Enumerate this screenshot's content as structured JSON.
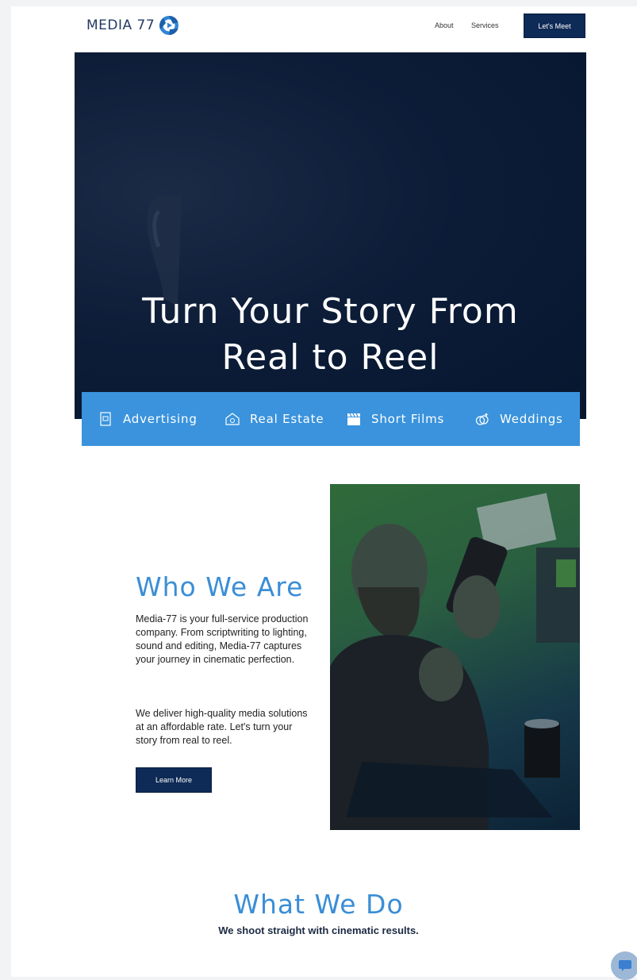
{
  "header": {
    "logo_text": "MEDIA 77",
    "nav": [
      "About",
      "Services"
    ],
    "cta_label": "Let's Meet"
  },
  "hero": {
    "title_line1": "Turn Your Story From",
    "title_line2": "Real to Reel"
  },
  "services": [
    {
      "label": "Advertising",
      "icon": "document-icon"
    },
    {
      "label": "Real Estate",
      "icon": "house-icon"
    },
    {
      "label": "Short Films",
      "icon": "clapperboard-icon"
    },
    {
      "label": "Weddings",
      "icon": "rings-icon"
    }
  ],
  "who": {
    "title": "Who We Are",
    "paragraph1": "Media-77 is your full-service production company. From scriptwriting to lighting, sound and editing, Media-77 captures your journey in cinematic perfection.",
    "paragraph2": "We deliver high-quality media solutions at an affordable rate. Let's turn your story from real to reel.",
    "button_label": "Learn More"
  },
  "what": {
    "title": "What We Do",
    "subtitle": "We shoot straight with cinematic results."
  },
  "colors": {
    "brand_navy": "#0e2a56",
    "accent_blue": "#3a93dc",
    "heading_blue": "#3a8ed6"
  }
}
